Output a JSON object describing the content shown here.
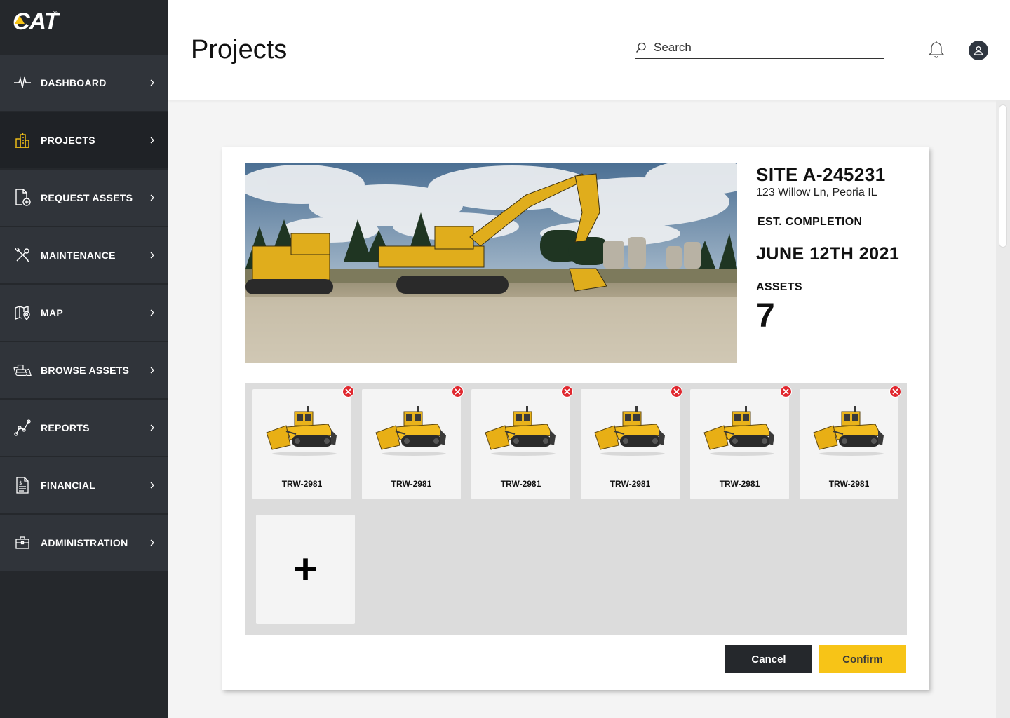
{
  "brand": {
    "name": "CAT",
    "reg": "®",
    "accent": "#f7c417",
    "sidebar_bg": "#25282c"
  },
  "sidebar": {
    "items": [
      {
        "label": "DASHBOARD",
        "icon": "pulse-icon"
      },
      {
        "label": "PROJECTS",
        "icon": "buildings-icon",
        "active": true
      },
      {
        "label": "REQUEST ASSETS",
        "icon": "file-add-icon"
      },
      {
        "label": "MAINTENANCE",
        "icon": "tools-icon"
      },
      {
        "label": "MAP",
        "icon": "map-pin-icon"
      },
      {
        "label": "BROWSE ASSETS",
        "icon": "bulldozer-icon"
      },
      {
        "label": "REPORTS",
        "icon": "chart-nodes-icon"
      },
      {
        "label": "FINANCIAL",
        "icon": "invoice-icon"
      },
      {
        "label": "ADMINISTRATION",
        "icon": "briefcase-icon"
      }
    ]
  },
  "header": {
    "title": "Projects",
    "search_placeholder": "Search"
  },
  "project": {
    "site_name": "SITE A-245231",
    "address": "123 Willow Ln, Peoria IL",
    "est_label": "EST. COMPLETION",
    "est_date": "JUNE 12TH 2021",
    "assets_label": "ASSETS",
    "assets_count": "7"
  },
  "assets": [
    {
      "id": "TRW-2981"
    },
    {
      "id": "TRW-2981"
    },
    {
      "id": "TRW-2981"
    },
    {
      "id": "TRW-2981"
    },
    {
      "id": "TRW-2981"
    },
    {
      "id": "TRW-2981"
    }
  ],
  "actions": {
    "add": "+",
    "cancel": "Cancel",
    "confirm": "Confirm"
  }
}
